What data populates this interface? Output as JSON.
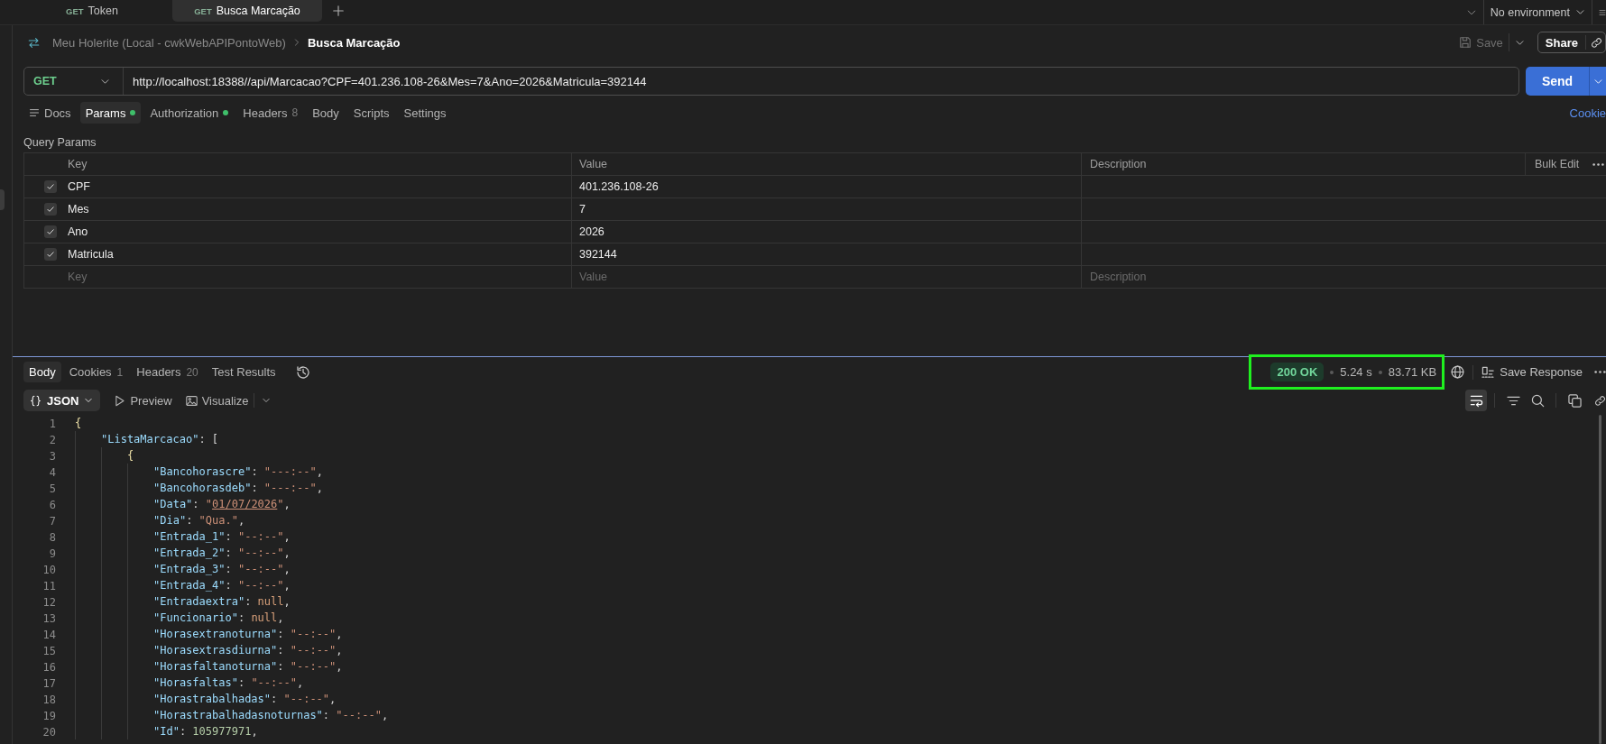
{
  "tabs": [
    {
      "method": "GET",
      "title": "Token",
      "selected": false
    },
    {
      "method": "GET",
      "title": "Busca Marcação",
      "selected": true
    }
  ],
  "environment": {
    "label": "No environment"
  },
  "breadcrumb": {
    "collection": "Meu Holerite (Local - cwkWebAPIPontoWeb)",
    "request": "Busca Marcação"
  },
  "save": {
    "label": "Save",
    "disabled": true
  },
  "share": {
    "label": "Share"
  },
  "request": {
    "method": "GET",
    "url": "http://localhost:18388//api/Marcacao?CPF=401.236.108-26&Mes=7&Ano=2026&Matricula=392144",
    "send": "Send"
  },
  "request_tabs": [
    {
      "kind": "docs",
      "label": "Docs",
      "selected": false,
      "dot": false
    },
    {
      "kind": "plain",
      "label": "Params",
      "selected": true,
      "dot": true
    },
    {
      "kind": "plain",
      "label": "Authorization",
      "selected": false,
      "dot": true
    },
    {
      "kind": "plain",
      "label": "Headers",
      "count": "8",
      "selected": false,
      "dot": false
    },
    {
      "kind": "plain",
      "label": "Body",
      "selected": false,
      "dot": false
    },
    {
      "kind": "plain",
      "label": "Scripts",
      "selected": false,
      "dot": false
    },
    {
      "kind": "plain",
      "label": "Settings",
      "selected": false,
      "dot": false
    }
  ],
  "cookies_link": "Cookie",
  "query_params": {
    "title": "Query Params",
    "columns": [
      "Key",
      "Value",
      "Description"
    ],
    "bulk_edit": "Bulk Edit",
    "rows": [
      {
        "checked": true,
        "key": "CPF",
        "value": "401.236.108-26"
      },
      {
        "checked": true,
        "key": "Mes",
        "value": "7"
      },
      {
        "checked": true,
        "key": "Ano",
        "value": "2026"
      },
      {
        "checked": true,
        "key": "Matricula",
        "value": "392144"
      }
    ],
    "new_row": {
      "key_placeholder": "Key",
      "value_placeholder": "Value",
      "description_placeholder": "Description"
    }
  },
  "response": {
    "tabs": [
      {
        "label": "Body",
        "selected": true
      },
      {
        "label": "Cookies",
        "count": "1",
        "selected": false
      },
      {
        "label": "Headers",
        "count": "20",
        "selected": false
      },
      {
        "label": "Test Results",
        "selected": false
      }
    ],
    "status": {
      "code": "200 OK",
      "time": "5.24 s",
      "size": "83.71 KB",
      "highlighted": true
    },
    "save_response": "Save Response",
    "format": "JSON",
    "views": [
      {
        "kind": "preview",
        "label": "Preview"
      },
      {
        "kind": "visualize",
        "label": "Visualize"
      }
    ],
    "lines": [
      {
        "number": "1",
        "tokens": [
          {
            "kind": "brace",
            "text": "{"
          }
        ],
        "children": [
          {
            "number": "2",
            "tokens": [
              {
                "kind": "key",
                "text": "\"ListaMarcacao\""
              },
              {
                "kind": "punct",
                "text": ": ["
              }
            ],
            "children": [
              {
                "number": "3",
                "tokens": [
                  {
                    "kind": "brace",
                    "text": "{"
                  }
                ],
                "children": [
                  {
                    "number": "4",
                    "tokens": [
                      {
                        "kind": "key",
                        "text": "\"Bancohorascre\""
                      },
                      {
                        "kind": "punct",
                        "text": ": "
                      },
                      {
                        "kind": "string",
                        "text": "\"---:--\""
                      },
                      {
                        "kind": "punct",
                        "text": ","
                      }
                    ]
                  },
                  {
                    "number": "5",
                    "tokens": [
                      {
                        "kind": "key",
                        "text": "\"Bancohorasdeb\""
                      },
                      {
                        "kind": "punct",
                        "text": ": "
                      },
                      {
                        "kind": "string",
                        "text": "\"---:--\""
                      },
                      {
                        "kind": "punct",
                        "text": ","
                      }
                    ]
                  },
                  {
                    "number": "6",
                    "tokens": [
                      {
                        "kind": "key",
                        "text": "\"Data\""
                      },
                      {
                        "kind": "punct",
                        "text": ": "
                      },
                      {
                        "kind": "string",
                        "text": "\""
                      },
                      {
                        "kind": "link",
                        "text": "01/07/2026"
                      },
                      {
                        "kind": "string",
                        "text": "\""
                      },
                      {
                        "kind": "punct",
                        "text": ","
                      }
                    ]
                  },
                  {
                    "number": "7",
                    "tokens": [
                      {
                        "kind": "key",
                        "text": "\"Dia\""
                      },
                      {
                        "kind": "punct",
                        "text": ": "
                      },
                      {
                        "kind": "string",
                        "text": "\"Qua.\""
                      },
                      {
                        "kind": "punct",
                        "text": ","
                      }
                    ]
                  },
                  {
                    "number": "8",
                    "tokens": [
                      {
                        "kind": "key",
                        "text": "\"Entrada_1\""
                      },
                      {
                        "kind": "punct",
                        "text": ": "
                      },
                      {
                        "kind": "string",
                        "text": "\"--:--\""
                      },
                      {
                        "kind": "punct",
                        "text": ","
                      }
                    ]
                  },
                  {
                    "number": "9",
                    "tokens": [
                      {
                        "kind": "key",
                        "text": "\"Entrada_2\""
                      },
                      {
                        "kind": "punct",
                        "text": ": "
                      },
                      {
                        "kind": "string",
                        "text": "\"--:--\""
                      },
                      {
                        "kind": "punct",
                        "text": ","
                      }
                    ]
                  },
                  {
                    "number": "10",
                    "tokens": [
                      {
                        "kind": "key",
                        "text": "\"Entrada_3\""
                      },
                      {
                        "kind": "punct",
                        "text": ": "
                      },
                      {
                        "kind": "string",
                        "text": "\"--:--\""
                      },
                      {
                        "kind": "punct",
                        "text": ","
                      }
                    ]
                  },
                  {
                    "number": "11",
                    "tokens": [
                      {
                        "kind": "key",
                        "text": "\"Entrada_4\""
                      },
                      {
                        "kind": "punct",
                        "text": ": "
                      },
                      {
                        "kind": "string",
                        "text": "\"--:--\""
                      },
                      {
                        "kind": "punct",
                        "text": ","
                      }
                    ]
                  },
                  {
                    "number": "12",
                    "tokens": [
                      {
                        "kind": "key",
                        "text": "\"Entradaextra\""
                      },
                      {
                        "kind": "punct",
                        "text": ": "
                      },
                      {
                        "kind": "null",
                        "text": "null"
                      },
                      {
                        "kind": "punct",
                        "text": ","
                      }
                    ]
                  },
                  {
                    "number": "13",
                    "tokens": [
                      {
                        "kind": "key",
                        "text": "\"Funcionario\""
                      },
                      {
                        "kind": "punct",
                        "text": ": "
                      },
                      {
                        "kind": "null",
                        "text": "null"
                      },
                      {
                        "kind": "punct",
                        "text": ","
                      }
                    ]
                  },
                  {
                    "number": "14",
                    "tokens": [
                      {
                        "kind": "key",
                        "text": "\"Horasextranoturna\""
                      },
                      {
                        "kind": "punct",
                        "text": ": "
                      },
                      {
                        "kind": "string",
                        "text": "\"--:--\""
                      },
                      {
                        "kind": "punct",
                        "text": ","
                      }
                    ]
                  },
                  {
                    "number": "15",
                    "tokens": [
                      {
                        "kind": "key",
                        "text": "\"Horasextrasdiurna\""
                      },
                      {
                        "kind": "punct",
                        "text": ": "
                      },
                      {
                        "kind": "string",
                        "text": "\"--:--\""
                      },
                      {
                        "kind": "punct",
                        "text": ","
                      }
                    ]
                  },
                  {
                    "number": "16",
                    "tokens": [
                      {
                        "kind": "key",
                        "text": "\"Horasfaltanoturna\""
                      },
                      {
                        "kind": "punct",
                        "text": ": "
                      },
                      {
                        "kind": "string",
                        "text": "\"--:--\""
                      },
                      {
                        "kind": "punct",
                        "text": ","
                      }
                    ]
                  },
                  {
                    "number": "17",
                    "tokens": [
                      {
                        "kind": "key",
                        "text": "\"Horasfaltas\""
                      },
                      {
                        "kind": "punct",
                        "text": ": "
                      },
                      {
                        "kind": "string",
                        "text": "\"--:--\""
                      },
                      {
                        "kind": "punct",
                        "text": ","
                      }
                    ]
                  },
                  {
                    "number": "18",
                    "tokens": [
                      {
                        "kind": "key",
                        "text": "\"Horastrabalhadas\""
                      },
                      {
                        "kind": "punct",
                        "text": ": "
                      },
                      {
                        "kind": "string",
                        "text": "\"--:--\""
                      },
                      {
                        "kind": "punct",
                        "text": ","
                      }
                    ]
                  },
                  {
                    "number": "19",
                    "tokens": [
                      {
                        "kind": "key",
                        "text": "\"Horastrabalhadasnoturnas\""
                      },
                      {
                        "kind": "punct",
                        "text": ": "
                      },
                      {
                        "kind": "string",
                        "text": "\"--:--\""
                      },
                      {
                        "kind": "punct",
                        "text": ","
                      }
                    ]
                  },
                  {
                    "number": "20",
                    "tokens": [
                      {
                        "kind": "key",
                        "text": "\"Id\""
                      },
                      {
                        "kind": "punct",
                        "text": ": "
                      },
                      {
                        "kind": "number",
                        "text": "105977971"
                      },
                      {
                        "kind": "punct",
                        "text": ","
                      }
                    ]
                  }
                ]
              }
            ]
          }
        ]
      }
    ]
  }
}
